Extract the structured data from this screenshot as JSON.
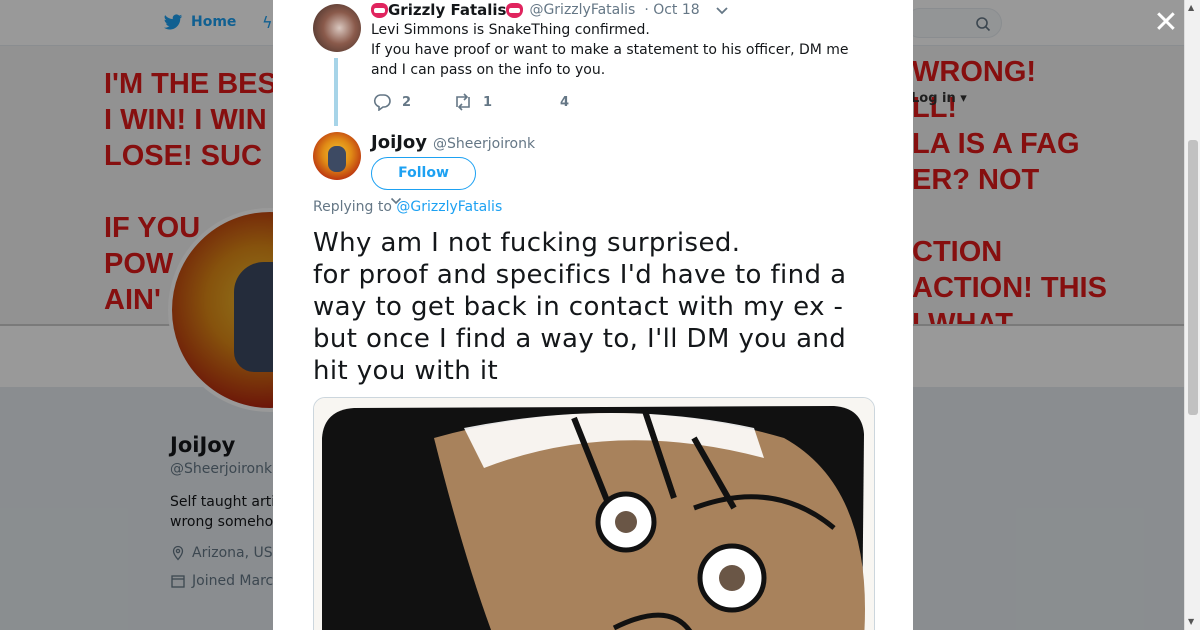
{
  "background": {
    "nav": {
      "home_label": "Home",
      "login_label": "Log in"
    },
    "banner": {
      "left_text": "I'M THE BES\nI WIN! I WIN\nLOSE! SUC\n\nIF YOU\nPOW\nAIN'",
      "right_text": "WRONG!\nLL!\nLA IS A FAG\nER? NOT\n\nCTION\nACTION! THIS\nI WHAT",
      "text_color": "#e01a1a"
    },
    "profile": {
      "name": "JoiJoy",
      "handle": "@Sheerjoironk",
      "bio_line1": "Self taught arti",
      "bio_line2": "wrong someho",
      "location": "Arizona, US",
      "joined": "Joined Marc"
    }
  },
  "modal": {
    "close_icon": "close-x",
    "parent_tweet": {
      "name": "Grizzly Fatalis",
      "handle": "@GrizzlyFatalis",
      "time": "· Oct 18",
      "text_line1": "Levi Simmons is SnakeThing confirmed.",
      "text_line2": "If you have proof or want to make a statement to his officer, DM me and I can pass on the info to you.",
      "reply_count": "2",
      "retweet_count": "1",
      "like_count": "4"
    },
    "main_tweet": {
      "name": "JoiJoy",
      "handle": "@Sheerjoironk",
      "follow_label": "Follow",
      "replying_prefix": "Replying to",
      "replying_mention": "@GrizzlyFatalis",
      "text_lines": [
        "Why am I not fucking surprised.",
        "for proof and specifics I'd have to find a",
        "way to get back in contact with my ex -",
        "but once I find a way to, I'll DM you and",
        "hit you with it"
      ]
    }
  },
  "colors": {
    "accent": "#1da1f2",
    "text": "#14171a",
    "muted": "#657786",
    "thread_line": "#a7d4e8"
  }
}
